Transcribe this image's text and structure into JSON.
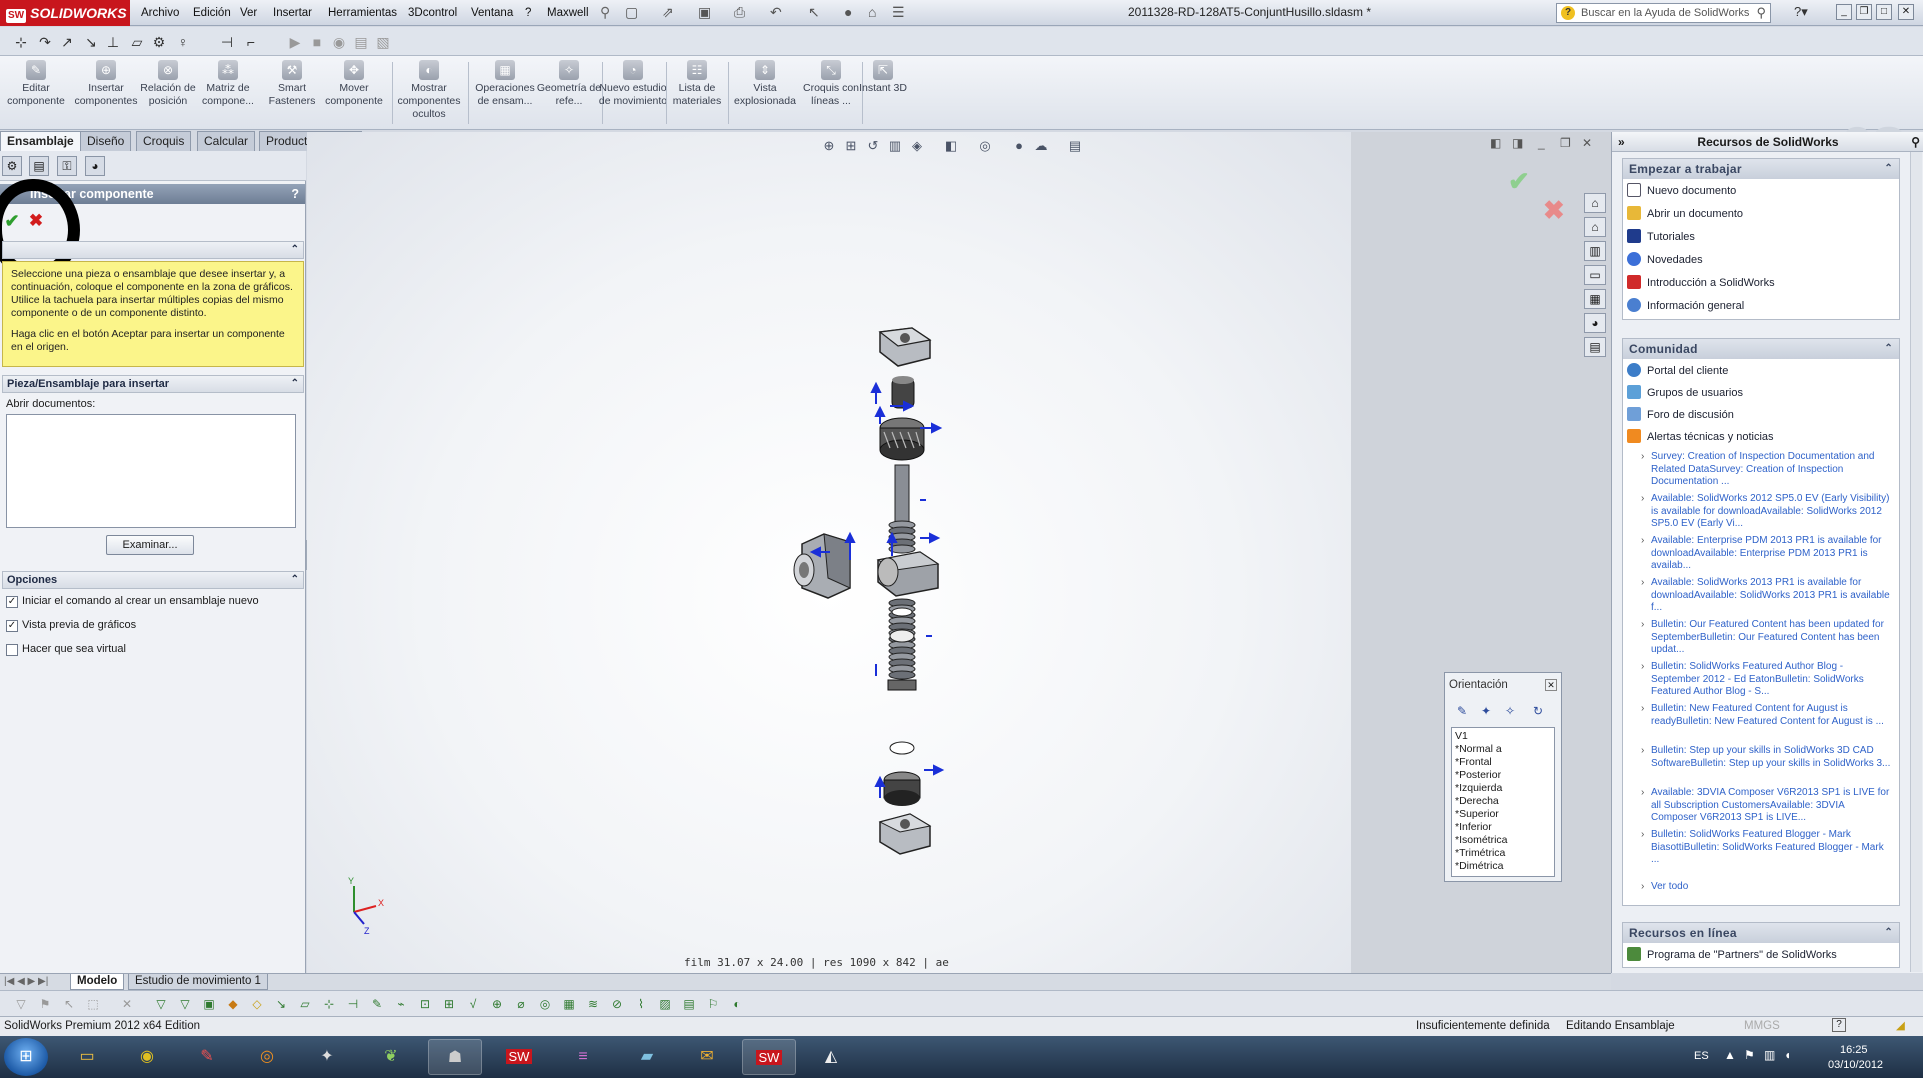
{
  "app": {
    "logo": "SOLIDWORKS",
    "document_title": "2011328-RD-128AT5-ConjuntHusillo.sldasm *",
    "help_search_placeholder": "Buscar en la Ayuda de SolidWorks"
  },
  "menu": [
    "Archivo",
    "Edición",
    "Ver",
    "Insertar",
    "Herramientas",
    "3Dcontrol",
    "Ventana",
    "?",
    "Maxwell"
  ],
  "commands": [
    {
      "label": "Editar componente",
      "icon": "edit-component-icon"
    },
    {
      "label": "Insertar componentes",
      "icon": "insert-components-icon"
    },
    {
      "label": "Relación de posición",
      "icon": "mate-icon"
    },
    {
      "label": "Matriz de compone...",
      "icon": "component-pattern-icon"
    },
    {
      "label": "Smart Fasteners",
      "icon": "smart-fasteners-icon"
    },
    {
      "label": "Mover componente",
      "icon": "move-component-icon"
    },
    {
      "label": "Mostrar componentes ocultos",
      "icon": "show-hidden-icon"
    },
    {
      "label": "Operaciones de ensam...",
      "icon": "assembly-features-icon"
    },
    {
      "label": "Geometría de refe...",
      "icon": "reference-geometry-icon"
    },
    {
      "label": "Nuevo estudio de movimiento",
      "icon": "motion-study-icon"
    },
    {
      "label": "Lista de materiales",
      "icon": "bom-icon"
    },
    {
      "label": "Vista explosionada",
      "icon": "exploded-view-icon"
    },
    {
      "label": "Croquis con líneas ...",
      "icon": "explode-line-sketch-icon"
    },
    {
      "label": "Instant 3D",
      "icon": "instant3d-icon"
    }
  ],
  "tabs": [
    "Ensamblaje",
    "Diseño",
    "Croquis",
    "Calcular",
    "Productos Office"
  ],
  "property_manager": {
    "title": "Insertar componente",
    "message_p1": "Seleccione una pieza o ensamblaje que desee insertar y, a continuación, coloque el componente en la zona de gráficos. Utilice la tachuela para insertar múltiples copias del mismo componente o de un componente distinto.",
    "message_p2": "Haga clic en el botón Aceptar para insertar un componente en el origen.",
    "section_part": "Pieza/Ensamblaje para insertar",
    "open_docs_label": "Abrir documentos:",
    "browse_label": "Examinar...",
    "section_options": "Opciones",
    "options": [
      {
        "label": "Iniciar el comando al crear un ensamblaje nuevo",
        "checked": true
      },
      {
        "label": "Vista previa de gráficos",
        "checked": true
      },
      {
        "label": "Hacer que sea virtual",
        "checked": false
      }
    ]
  },
  "graphics": {
    "status_line": "film 31.07 x 24.00   |   res 1090 x 842   |   ae",
    "triad": {
      "x": "X",
      "y": "Y",
      "z": "Z"
    }
  },
  "orientation": {
    "title": "Orientación",
    "views": [
      "V1",
      "*Normal a",
      "*Frontal",
      "*Posterior",
      "*Izquierda",
      "*Derecha",
      "*Superior",
      "*Inferior",
      "*Isométrica",
      "*Trimétrica",
      "*Dimétrica"
    ]
  },
  "task_pane": {
    "title": "Recursos de SolidWorks",
    "getting_started": {
      "title": "Empezar a trabajar",
      "items": [
        "Nuevo documento",
        "Abrir un documento",
        "Tutoriales",
        "Novedades",
        "Introducción a SolidWorks",
        "Información general"
      ]
    },
    "community": {
      "title": "Comunidad",
      "items": [
        "Portal del cliente",
        "Grupos de usuarios",
        "Foro de discusión",
        "Alertas técnicas y noticias"
      ],
      "news": [
        "Survey: Creation of Inspection Documentation and Related DataSurvey: Creation of Inspection Documentation ...",
        "Available: SolidWorks 2012 SP5.0 EV (Early Visibility) is available for downloadAvailable: SolidWorks 2012 SP5.0 EV (Early Vi...",
        "Available: Enterprise PDM 2013 PR1 is available for downloadAvailable: Enterprise PDM 2013 PR1 is availab...",
        "Available: SolidWorks 2013 PR1 is available for downloadAvailable: SolidWorks 2013 PR1 is available f...",
        "Bulletin: Our Featured Content has been updated for SeptemberBulletin: Our Featured Content has been updat...",
        "Bulletin: SolidWorks Featured Author Blog - September 2012 - Ed EatonBulletin: SolidWorks Featured Author Blog - S...",
        "Bulletin: New Featured Content for August is readyBulletin: New Featured Content for August is ...",
        "Bulletin: Step up your skills in SolidWorks 3D CAD SoftwareBulletin: Step up your skills in SolidWorks 3...",
        "Available: 3DVIA Composer V6R2013 SP1 is LIVE for all Subscription CustomersAvailable: 3DVIA Composer V6R2013 SP1 is LIVE...",
        "Bulletin: SolidWorks Featured Blogger - Mark BiasottiBulletin: SolidWorks Featured Blogger - Mark ..."
      ],
      "see_all": "Ver todo"
    },
    "online": {
      "title": "Recursos en línea",
      "items": [
        "Programa de \"Partners\" de SolidWorks"
      ]
    }
  },
  "bottom_tabs": [
    "Modelo",
    "Estudio de movimiento 1"
  ],
  "status_bar": {
    "edition": "SolidWorks Premium 2012 x64 Edition",
    "definition": "Insuficientemente definida",
    "mode": "Editando Ensamblaje",
    "units": "MMGS"
  },
  "taskbar": {
    "lang": "ES",
    "time": "16:25",
    "date": "03/10/2012"
  }
}
